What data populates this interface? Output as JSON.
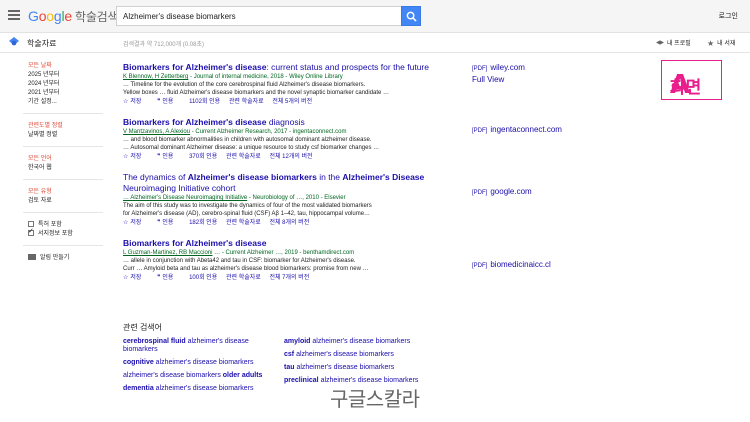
{
  "header": {
    "logo_google": [
      "G",
      "o",
      "o",
      "g",
      "l",
      "e"
    ],
    "logo_scholar": "학술검색",
    "search_value": "Alzheimer's disease biomarkers",
    "login": "로그인"
  },
  "subbar": {
    "title": "학술자료",
    "stats": "검색결과 약 712,000개 (0.08초)",
    "profile": "내 프로필",
    "library": "내 서재"
  },
  "sidebar": {
    "time": [
      "모든 날짜",
      "2025 년부터",
      "2024 년부터",
      "2021 년부터",
      "기간 설정..."
    ],
    "sort": [
      "관련도별 정렬",
      "날짜별 정렬"
    ],
    "lang": [
      "모든 언어",
      "한국어 웹"
    ],
    "type": [
      "모든 유형",
      "검토 자료"
    ],
    "check_patents": "특허 포함",
    "check_citations": "서지정보 포함",
    "alert": "알림 만들기"
  },
  "results": [
    {
      "title_parts": [
        "Biomarkers for ",
        "Alzheimer's disease",
        ": current status and prospects for the future"
      ],
      "authors_links": "K Blennow, H Zetterberg",
      "authors_rest": " - Journal of internal medicine, 2018 - Wiley Online Library",
      "snippet1": "… Timeline for the evolution of the core cerebrospinal fluid Alzheimer's disease biomarkers.",
      "snippet2": "Yellow boxes … fluid Alzheimer's disease biomarkers and the novel synaptic biomarker candidate …",
      "save": "저장",
      "cite": "인용",
      "cited_by": "1102회 인용",
      "related": "관련 학술자료",
      "versions": "전체 5개의 버전",
      "link_tag": "[PDF]",
      "link_text": "wiley.com",
      "link_extra": "Full View"
    },
    {
      "title_parts": [
        "Biomarkers for ",
        "Alzheimer's disease",
        " diagnosis"
      ],
      "authors_links": "V Mantzavinos, A Alexiou",
      "authors_rest": " - Current Alzheimer Research, 2017 - ingentaconnect.com",
      "snippet1": "… and blood biomarker abnormalities in children with autosomal dominant alzheimer disease.",
      "snippet2": "… Autosomal dominant Alzheimer disease: a unique resource to study csf biomarker changes …",
      "save": "저장",
      "cite": "인용",
      "cited_by": "370회 인용",
      "related": "관련 학술자료",
      "versions": "전체 12개의 버전",
      "link_tag": "[PDF]",
      "link_text": "ingentaconnect.com",
      "link_extra": ""
    },
    {
      "title_parts": [
        "The dynamics of ",
        "Alzheimer's disease biomarkers",
        " in the ",
        "Alzheimer's Disease",
        " Neuroimaging Initiative cohort"
      ],
      "authors_links": "… Alzheimer's Disease Neuroimaging Initiative",
      "authors_rest": " - Neurobiology of …, 2010 - Elsevier",
      "snippet1": "The aim of this study was to investigate the dynamics of four of the most validated biomarkers",
      "snippet2": "for Alzheimer's disease (AD), cerebro-spinal fluid (CSF) Aβ 1–42, tau, hippocampal volume…",
      "save": "저장",
      "cite": "인용",
      "cited_by": "182회 인용",
      "related": "관련 학술자료",
      "versions": "전체 8개의 버전",
      "link_tag": "[PDF]",
      "link_text": "google.com",
      "link_extra": ""
    },
    {
      "title_parts": [
        "Biomarkers for ",
        "Alzheimer's disease",
        ""
      ],
      "authors_links": "L Guzman-Martinez, RB Maccioni",
      "authors_rest": " … - Current Alzheimer …, 2019 - benthamdirect.com",
      "snippet1": "… allele in conjunction with Abeta42 and tau in CSF: biomarker for Alzheimer's disease.",
      "snippet2": "Curr … Amyloid beta and tau as alzheimer's disease blood biomarkers: promise from new …",
      "save": "저장",
      "cite": "인용",
      "cited_by": "100회 인용",
      "related": "관련 학술자료",
      "versions": "전체 7개의 버전",
      "link_tag": "[PDF]",
      "link_text": "biomedicinaicc.cl",
      "link_extra": ""
    }
  ],
  "related": {
    "title": "관련 검색어",
    "left": [
      {
        "bold": "cerebrospinal fluid",
        "rest": " alzheimer's disease biomarkers"
      },
      {
        "bold": "cognitive",
        "rest": " alzheimer's disease biomarkers"
      },
      {
        "bold": "",
        "rest": "alzheimer's disease biomarkers ",
        "bold2": "older adults"
      },
      {
        "bold": "dementia",
        "rest": " alzheimer's disease biomarkers"
      }
    ],
    "right": [
      {
        "bold": "amyloid",
        "rest": " alzheimer's disease biomarkers"
      },
      {
        "bold": "csf",
        "rest": " alzheimer's disease biomarkers"
      },
      {
        "bold": "tau",
        "rest": " alzheimer's disease biomarkers"
      },
      {
        "bold": "preclinical",
        "rest": " alzheimer's disease biomarkers"
      }
    ]
  },
  "overlay": {
    "screen_label": "화면",
    "screen_letter": "A",
    "watermark": "구글스칼라"
  },
  "colors": {
    "link": "#1a0dab",
    "green": "#006621",
    "red": "#dd4b39",
    "label_pink": "#e91e8c",
    "search_blue": "#4285f4"
  }
}
